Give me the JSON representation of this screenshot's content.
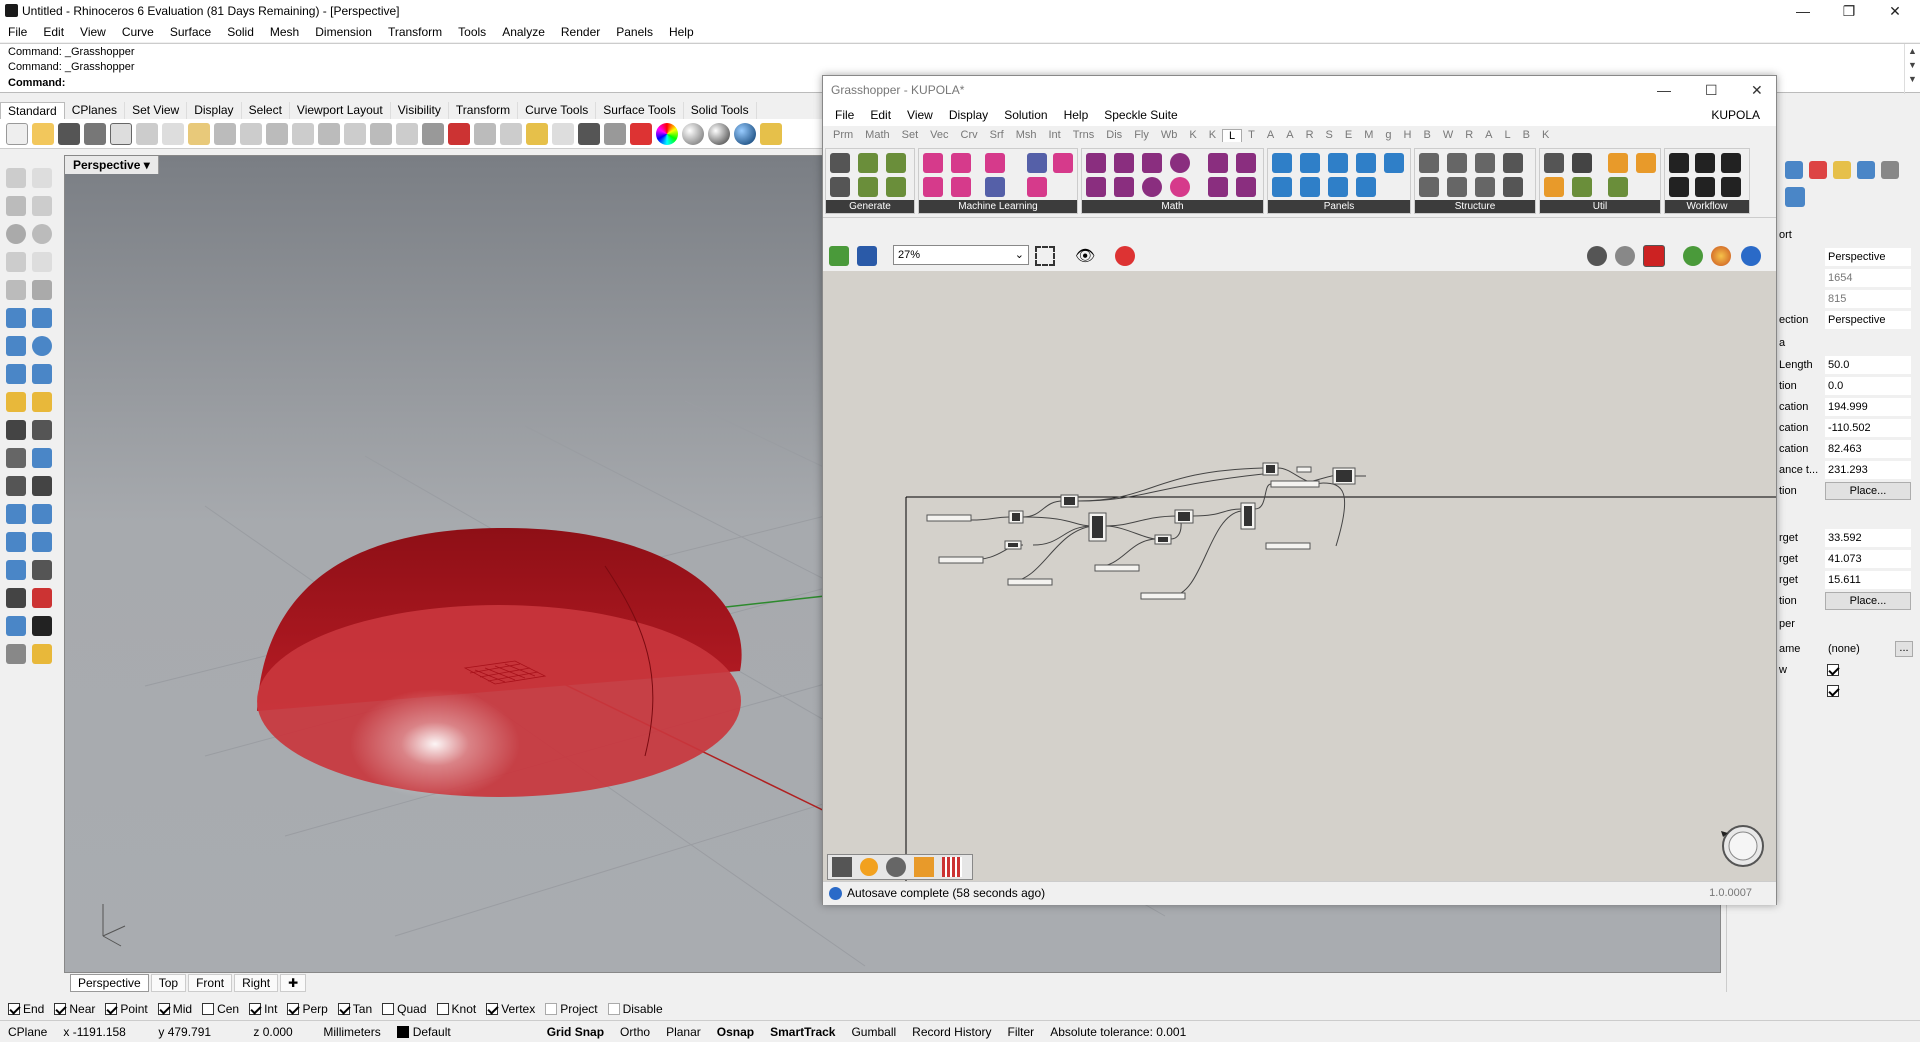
{
  "rhino": {
    "title": "Untitled - Rhinoceros 6 Evaluation (81 Days Remaining) - [Perspective]",
    "menu": [
      "File",
      "Edit",
      "View",
      "Curve",
      "Surface",
      "Solid",
      "Mesh",
      "Dimension",
      "Transform",
      "Tools",
      "Analyze",
      "Render",
      "Panels",
      "Help"
    ],
    "command_history": [
      "Command: _Grasshopper",
      "Command: _Grasshopper"
    ],
    "command_prompt": "Command:",
    "toolbar_tabs": [
      "Standard",
      "CPlanes",
      "Set View",
      "Display",
      "Select",
      "Viewport Layout",
      "Visibility",
      "Transform",
      "Curve Tools",
      "Surface Tools",
      "Solid Tools"
    ],
    "viewport_label": "Perspective",
    "viewport_tabs": [
      "Perspective",
      "Top",
      "Front",
      "Right"
    ],
    "osnaps": [
      {
        "label": "End",
        "checked": true
      },
      {
        "label": "Near",
        "checked": true
      },
      {
        "label": "Point",
        "checked": true
      },
      {
        "label": "Mid",
        "checked": true
      },
      {
        "label": "Cen",
        "checked": false
      },
      {
        "label": "Int",
        "checked": true
      },
      {
        "label": "Perp",
        "checked": true
      },
      {
        "label": "Tan",
        "checked": true
      },
      {
        "label": "Quad",
        "checked": false
      },
      {
        "label": "Knot",
        "checked": false
      },
      {
        "label": "Vertex",
        "checked": true
      },
      {
        "label": "Project",
        "checked": false
      },
      {
        "label": "Disable",
        "checked": false
      }
    ],
    "status": {
      "cplane": "CPlane",
      "x": "x -1191.158",
      "y": "y 479.791",
      "z": "z 0.000",
      "units": "Millimeters",
      "layer": "Default",
      "grid_snap": "Grid Snap",
      "ortho": "Ortho",
      "planar": "Planar",
      "osnap": "Osnap",
      "smarttrack": "SmartTrack",
      "gumball": "Gumball",
      "record_history": "Record History",
      "filter": "Filter",
      "tolerance": "Absolute tolerance: 0.001"
    },
    "properties": {
      "section_viewport": "ort",
      "title_value": "Perspective",
      "width": "1654",
      "height": "815",
      "projection_label": "ection",
      "projection": "Perspective",
      "camera_section": "a",
      "lens_label": "Length",
      "lens": "50.0",
      "rotation_label": "tion",
      "rotation": "0.0",
      "xloc_label": "cation",
      "xloc": "194.999",
      "yloc_label": "cation",
      "yloc": "-110.502",
      "zloc_label": "cation",
      "zloc": "82.463",
      "dist_label": "ance t...",
      "dist": "231.293",
      "loc_btn_label": "tion",
      "place": "Place...",
      "xtgt_label": "rget",
      "xtgt": "33.592",
      "ytgt_label": "rget",
      "ytgt": "41.073",
      "ztgt_label": "rget",
      "ztgt": "15.611",
      "tgt_btn_label": "tion",
      "wallpaper_section": "per",
      "filename_label": "ame",
      "filename": "(none)",
      "browse": "...",
      "show_label": "w",
      "gray_label": ""
    }
  },
  "grasshopper": {
    "title": "Grasshopper - KUPOLA*",
    "menu": [
      "File",
      "Edit",
      "View",
      "Display",
      "Solution",
      "Help",
      "Speckle Suite"
    ],
    "doc_name": "KUPOLA",
    "tabs": [
      "Prm",
      "Math",
      "Set",
      "Vec",
      "Crv",
      "Srf",
      "Msh",
      "Int",
      "Trns",
      "Dis",
      "Fly",
      "Wb",
      "K",
      "K",
      "L",
      "T",
      "A",
      "A",
      "R",
      "S",
      "E",
      "M",
      "g",
      "H",
      "B",
      "W",
      "R",
      "A",
      "L",
      "B",
      "K"
    ],
    "active_tab": "L",
    "ribbon_groups": [
      "Generate",
      "Machine Learning",
      "Math",
      "Panels",
      "Structure",
      "Util",
      "Workflow"
    ],
    "zoom": "27%",
    "status": "Autosave complete (58 seconds ago)",
    "version": "1.0.0007"
  },
  "colors": {
    "dome": "#b3141c",
    "accent": "#0078d7",
    "canvas": "#d4d1cb"
  }
}
